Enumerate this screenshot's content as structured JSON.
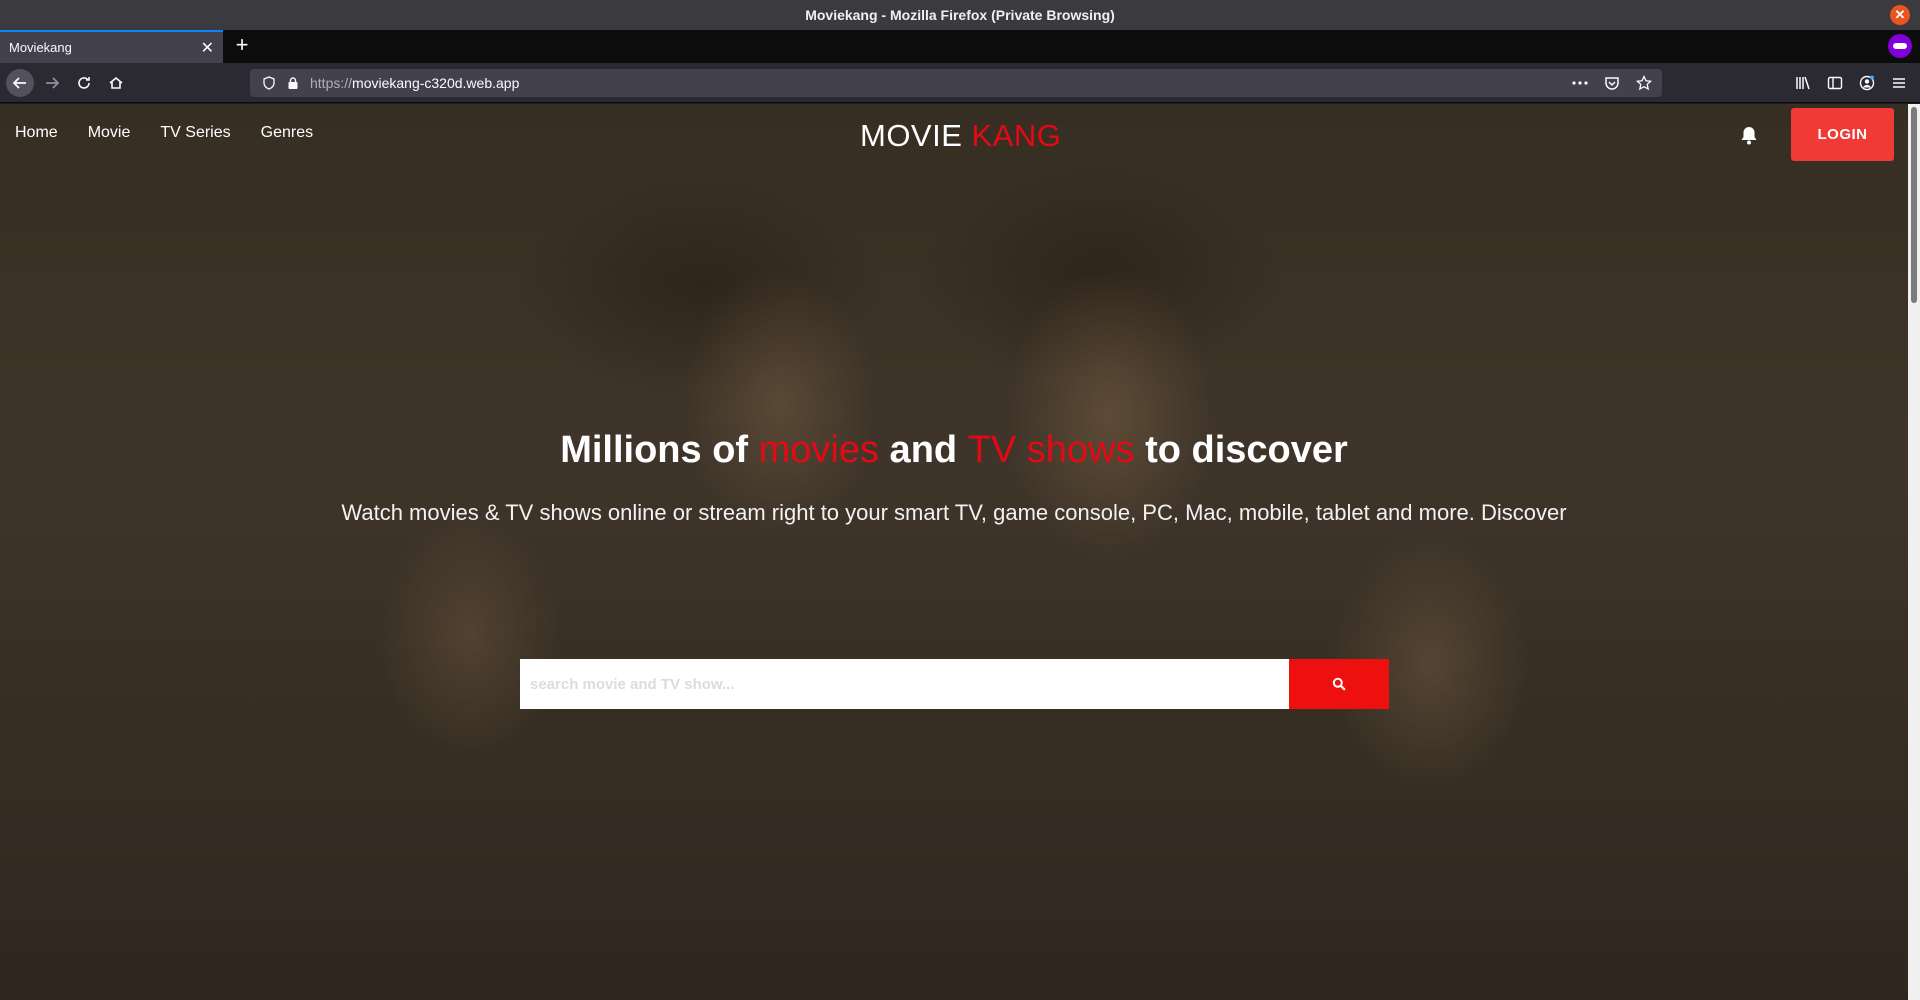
{
  "window": {
    "title": "Moviekang - Mozilla Firefox (Private Browsing)",
    "close_glyph": "✕"
  },
  "tabs": [
    {
      "label": "Moviekang",
      "close_glyph": "✕"
    }
  ],
  "new_tab_glyph": "+",
  "url": {
    "scheme": "https://",
    "host": "moviekang-c320d.web.app"
  },
  "site": {
    "nav": [
      "Home",
      "Movie",
      "TV Series",
      "Genres"
    ],
    "logo": {
      "part1": "MOVIE ",
      "part2": "KANG"
    },
    "login_label": "LOGIN",
    "hero": {
      "h_part1": "Millions of ",
      "h_movies": "movies",
      "h_part2": " and ",
      "h_tvshows": "TV shows",
      "h_part3": " to discover",
      "subtitle": "Watch movies & TV shows online or stream right to your smart TV, game console, PC, Mac, mobile, tablet and more. Discover"
    },
    "search": {
      "placeholder": "search movie and TV show..."
    }
  },
  "colors": {
    "accent_red": "#e50914",
    "login_red": "#ef3a35",
    "search_btn_red": "#ee0f0f"
  },
  "icons": [
    "shield-icon",
    "lock-icon",
    "search-icon",
    "bell-icon",
    "back-arrow-icon",
    "forward-arrow-icon",
    "reload-icon",
    "home-icon",
    "private-mask-icon",
    "library-icon",
    "sidebar-icon",
    "account-icon",
    "menu-icon",
    "more-icon",
    "pocket-icon",
    "bookmark-star-icon"
  ]
}
